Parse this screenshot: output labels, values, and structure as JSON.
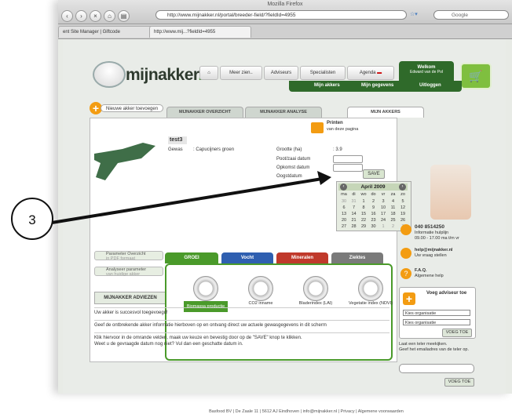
{
  "browser": {
    "title": "Mozilla Firefox",
    "url": "http://www.mijnakker.nl/portal/breeder-field/?fieldId=4955",
    "search_placeholder": "Google",
    "tabs": [
      "ent Site Manager | Giftcode",
      "http://www.mij...?fieldId=4955"
    ]
  },
  "header": {
    "logo_main": "mijnakker",
    "logo_suffix": ".nl",
    "nav": [
      "Meer zien..",
      "Adviseurs",
      "Specialisten",
      "Agenda"
    ],
    "welcome_title": "Welkom",
    "welcome_name": "Edward van de Pol",
    "subnav": [
      "Mijn akkers",
      "Mijn gegevens",
      "Uitloggen"
    ]
  },
  "tabs": {
    "new_field": "Nieuwe akker toevoegen",
    "items": [
      "MIJNAKKER OVERZICHT",
      "MIJNAKKER ANALYSE",
      "MIJN AKKERS"
    ]
  },
  "print": {
    "label": "Printen",
    "sub": "van deze pagina"
  },
  "field": {
    "name": "test3",
    "gewas_label": "Gewas",
    "gewas_value": ": Capucijners groen",
    "grootte_label": "Grootte (ha)",
    "grootte_value": ": 3.9",
    "poot_label": "Poot/zaai datum",
    "opkomst_label": "Opkomst datum",
    "oogst_label": "Oogstdatum",
    "save": "SAVE"
  },
  "calendar": {
    "title": "April 2009",
    "days": [
      "ma",
      "di",
      "wo",
      "do",
      "vr",
      "za",
      "zo"
    ],
    "weeks": [
      [
        "30",
        "31",
        "1",
        "2",
        "3",
        "4",
        "5"
      ],
      [
        "6",
        "7",
        "8",
        "9",
        "10",
        "11",
        "12"
      ],
      [
        "13",
        "14",
        "15",
        "16",
        "17",
        "18",
        "19"
      ],
      [
        "20",
        "21",
        "22",
        "23",
        "24",
        "25",
        "26"
      ],
      [
        "27",
        "28",
        "29",
        "30",
        "1",
        "2",
        "3"
      ]
    ]
  },
  "callout": {
    "number": "3"
  },
  "left_panel": {
    "btn1_title": "Parameter Overzicht",
    "btn1_sub": "in PDF formaat",
    "btn2_title": "Analyseer parameter",
    "btn2_sub": "van huidige akker",
    "adviezen": "MIJNAKKER ADVIEZEN"
  },
  "advice": {
    "tabs": [
      "GROEI",
      "Vocht",
      "Mineralen",
      "Ziektes"
    ],
    "tab_colors": [
      "#4a9a2a",
      "#2f5fb0",
      "#c0392b",
      "#7a7a7a"
    ],
    "gauges": [
      "Biomassa productie",
      "CO2 inname",
      "Bladerindex (LAI)",
      "Vegetatie index (NDVI)"
    ],
    "success": "Uw akker is succesvol toegevoegd!",
    "line1": "Geef de ontbrekende akker informatie hierboven op en ontvang direct uw actuele gewasgegevens in dit scherm",
    "line2": "Klik hiervoor in de omrande velden, maak uw keuze en bevestig door op de \"SAVE\" knop te klikken.",
    "line3": "Weet u de gevraagde datum nog niet? Vul dan een geschatte datum in."
  },
  "sidebar": {
    "phone": "040 8514250",
    "phone_sub1": "Informatie hulplijn",
    "phone_sub2": "09.00 - 17.00 ma t/m vr",
    "email": "help@mijnakker.nl",
    "email_sub": "Uw vraag stellen",
    "faq": "F.A.Q.",
    "faq_sub": "Algemene help",
    "voeg_title": "Voeg adviseur toe",
    "select1": "Kies organisatie",
    "select2": "Kies organisatie",
    "voeg_btn": "VOEG TOE",
    "invite1": "Laat een teler meekijken.",
    "invite2": "Geef het emailadres van de teler op.",
    "voeg_btn2": "VOEG TOE"
  },
  "footer": "Basfood BV | De Zaale 11 | 5612 AJ Eindhoven | info@mijnakker.nl | Privacy | Algemene voorwaarden"
}
